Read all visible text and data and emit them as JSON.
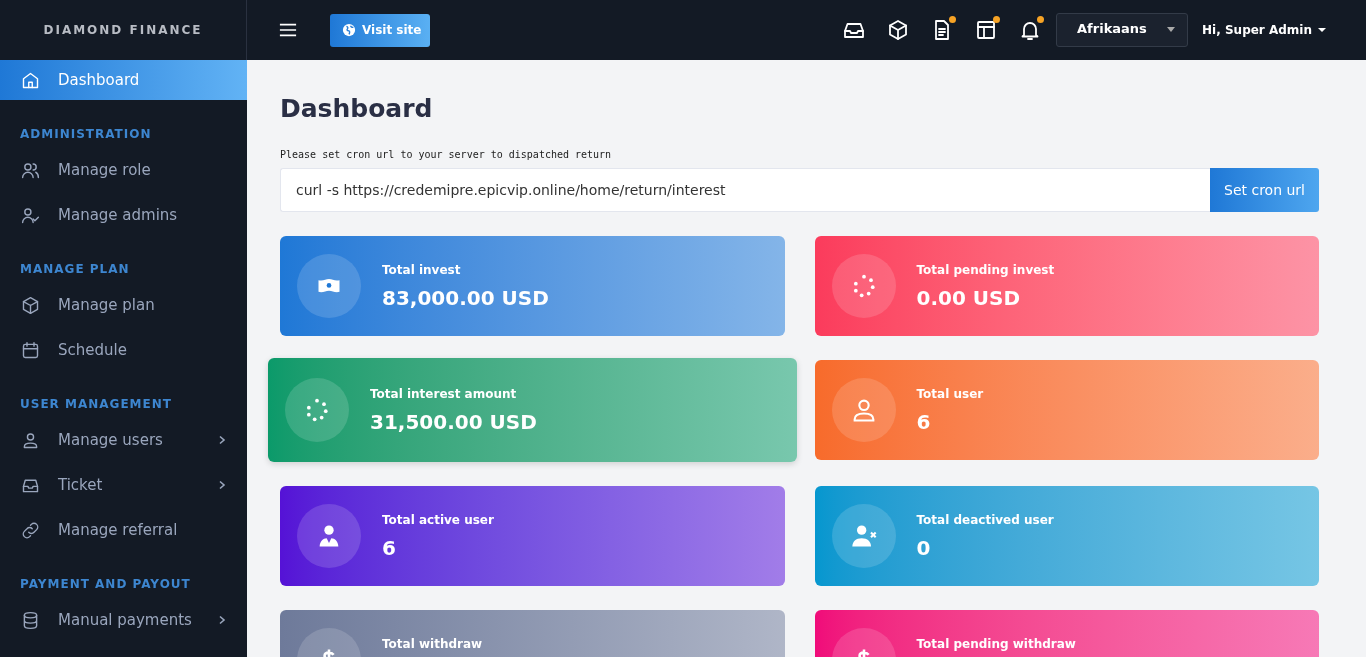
{
  "brand": "DIAMOND FINANCE",
  "sidebar": {
    "sections": [
      {
        "items": [
          {
            "label": "Dashboard",
            "kind": "home",
            "selected": true,
            "has_submenu": false
          }
        ]
      },
      {
        "heading": "ADMINISTRATION",
        "items": [
          {
            "label": "Manage role",
            "kind": "users",
            "selected": false,
            "has_submenu": false
          },
          {
            "label": "Manage admins",
            "kind": "user-check",
            "selected": false,
            "has_submenu": false
          }
        ]
      },
      {
        "heading": "MANAGE PLAN",
        "items": [
          {
            "label": "Manage plan",
            "kind": "box",
            "selected": false,
            "has_submenu": false
          },
          {
            "label": "Schedule",
            "kind": "calendar",
            "selected": false,
            "has_submenu": false
          }
        ]
      },
      {
        "heading": "USER MANAGEMENT",
        "items": [
          {
            "label": "Manage users",
            "kind": "user",
            "selected": false,
            "has_submenu": true
          },
          {
            "label": "Ticket",
            "kind": "inbox",
            "selected": false,
            "has_submenu": true
          },
          {
            "label": "Manage referral",
            "kind": "link",
            "selected": false,
            "has_submenu": false
          }
        ]
      },
      {
        "heading": "PAYMENT AND PAYOUT",
        "items": [
          {
            "label": "Manual payments",
            "kind": "database",
            "selected": false,
            "has_submenu": true
          }
        ]
      }
    ]
  },
  "topbar": {
    "visit_button": "Visit site",
    "icons": [
      {
        "kind": "inbox",
        "dot": false
      },
      {
        "kind": "box",
        "dot": false
      },
      {
        "kind": "file",
        "dot": true
      },
      {
        "kind": "layout",
        "dot": true
      },
      {
        "kind": "bell",
        "dot": true
      }
    ],
    "language": "Afrikaans",
    "user": "Hi, Super Admin"
  },
  "page_title": "Dashboard",
  "cron": {
    "hint": "Please set cron url to your server to dispatched return",
    "value": "curl -s https://credemipre.epicvip.online/home/return/interest",
    "button": "Set cron url"
  },
  "cards": [
    {
      "label": "Total invest",
      "value": "83,000.00 USD",
      "kind": "money",
      "color": "#1f78d6",
      "raised": false
    },
    {
      "label": "Total pending invest",
      "value": "0.00 USD",
      "kind": "spinner",
      "color": "#fb3b5c",
      "raised": false
    },
    {
      "label": "Total interest amount",
      "value": "31,500.00 USD",
      "kind": "spinner",
      "color": "#0a9a6a",
      "raised": true
    },
    {
      "label": "Total user",
      "value": "6",
      "kind": "user",
      "color": "#f76b2b",
      "raised": false
    },
    {
      "label": "Total active user",
      "value": "6",
      "kind": "user-tie",
      "color": "#5512d6",
      "raised": false
    },
    {
      "label": "Total deactived user",
      "value": "0",
      "kind": "user-x",
      "color": "#0597cf",
      "raised": false
    },
    {
      "label": "Total withdraw",
      "kind": "dollar",
      "color": "#6e7a9a",
      "raised": false
    },
    {
      "label": "Total pending withdraw",
      "kind": "dollar",
      "color": "#f00b7a",
      "raised": false
    }
  ]
}
